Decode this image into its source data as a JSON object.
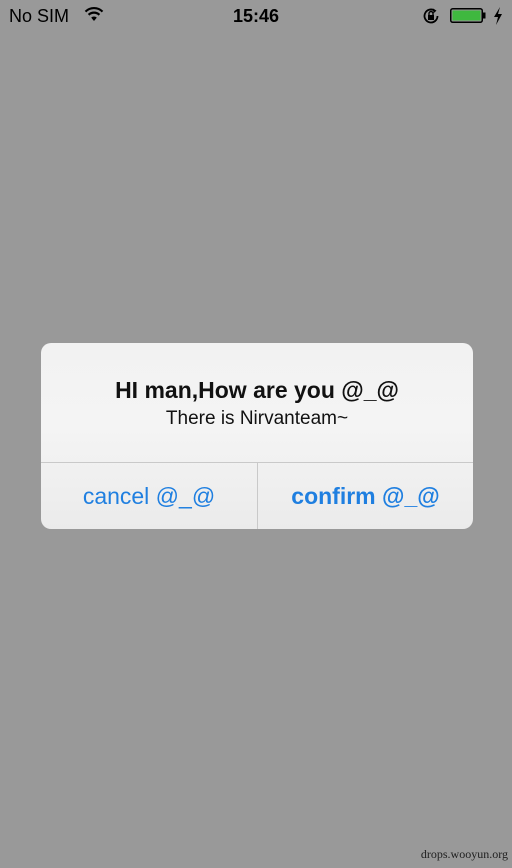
{
  "status_bar": {
    "carrier": "No SIM",
    "time": "15:46",
    "icons": [
      "wifi-icon",
      "orientation-lock-icon",
      "battery-icon",
      "charging-icon"
    ],
    "battery_color": "#3fb83f"
  },
  "alert": {
    "title": "HI man,How are you @_@",
    "message": "There is Nirvanteam~",
    "cancel_label": "cancel @_@",
    "confirm_label": "confirm @_@",
    "button_color": "#1f7fe0"
  },
  "watermark": "drops.wooyun.org",
  "colors": {
    "backdrop": "#999999",
    "alert_background": "#f2f2f2"
  }
}
